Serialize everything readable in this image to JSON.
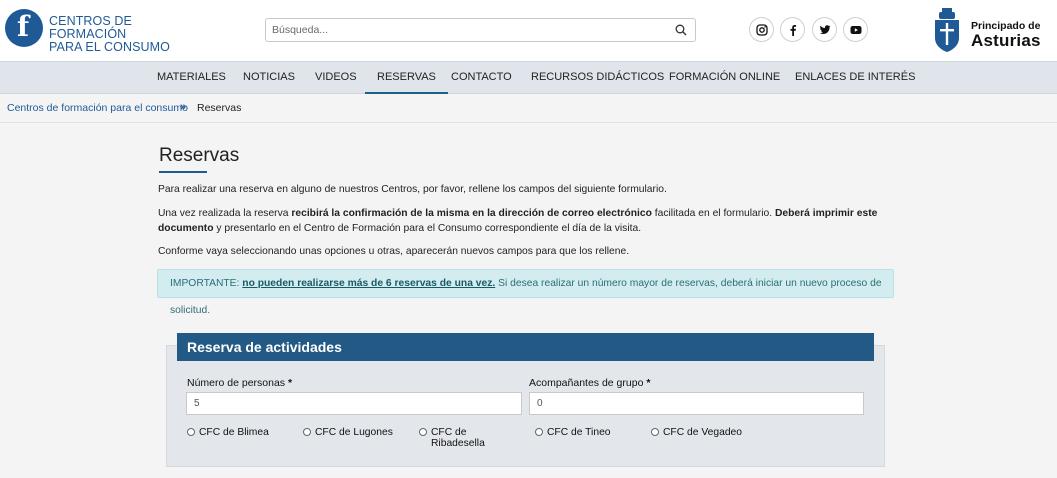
{
  "header": {
    "logo_line1": "CENTROS DE FORMACIÓN",
    "logo_line2": "PARA EL CONSUMO",
    "search_placeholder": "Búsqueda...",
    "social_icons": [
      "instagram-icon",
      "facebook-icon",
      "twitter-icon",
      "youtube-icon"
    ],
    "brand_small": "Principado de",
    "brand_big": "Asturias"
  },
  "nav": {
    "items": [
      "MATERIALES",
      "NOTICIAS",
      "VIDEOS",
      "RESERVAS",
      "CONTACTO",
      "RECURSOS DIDÁCTICOS",
      "FORMACIÓN ONLINE",
      "ENLACES DE INTERÉS"
    ],
    "active": "RESERVAS"
  },
  "breadcrumb": {
    "home": "Centros de formación para el consumo",
    "separator": "»",
    "current": "Reservas"
  },
  "page": {
    "title": "Reservas",
    "p1": "Para realizar una reserva en alguno de nuestros Centros, por favor, rellene los campos del siguiente formulario.",
    "p2_a": "Una vez realizada la reserva ",
    "p2_b": "recibirá la confirmación de la misma en la dirección de correo electrónico",
    "p2_c": " facilitada en el formulario. ",
    "p2_d": "Deberá imprimir este documento",
    "p2_e": "  y presentarlo en el Centro de Formación para el Consumo correspondiente el día de la visita.",
    "p3": "Conforme vaya seleccionando unas opciones u otras, aparecerán nuevos campos para que los rellene.",
    "notice_prefix": "IMPORTANTE: ",
    "notice_link": "no pueden realizarse más de 6 reservas de una vez.",
    "notice_suffix": " Si desea realizar un número mayor de reservas, deberá iniciar un nuevo proceso de solicitud."
  },
  "form": {
    "heading": "Reserva de actividades",
    "persons_label": "Número de personas",
    "persons_value": "5",
    "companions_label": "Acompañantes de grupo",
    "companions_value": "0",
    "required_mark": "*",
    "centers": [
      "CFC de Blimea",
      "CFC de Lugones",
      "CFC de Ribadesella",
      "CFC de Tineo",
      "CFC de Vegadeo"
    ]
  },
  "colors": {
    "brand_blue": "#1f5a96",
    "form_header": "#225985",
    "nav_bg": "#dfe5ea",
    "notice_bg": "#d3ecef"
  }
}
